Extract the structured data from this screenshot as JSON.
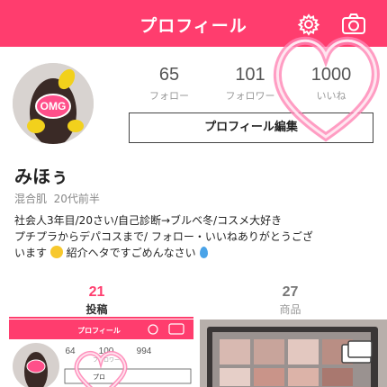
{
  "header": {
    "title": "プロフィール",
    "settings_icon": "gear-icon",
    "camera_icon": "camera-icon",
    "color": "#ff3d6e"
  },
  "avatar": {
    "badge_text": "OMG"
  },
  "stats": [
    {
      "value": "65",
      "label": "フォロー"
    },
    {
      "value": "101",
      "label": "フォロワー"
    },
    {
      "value": "1000",
      "label": "いいね"
    }
  ],
  "edit_button": "プロフィール編集",
  "profile": {
    "name": "みほぅ",
    "skin_type": "混合肌",
    "age": "20代前半",
    "bio_lines": [
      "社会人3年目/20さい/自己診断→ブルベ冬/コスメ大好き",
      "プチプラからデパコスまで/ フォロー・いいねありがとうござ",
      "います",
      "紹介ヘタですごめんなさい"
    ]
  },
  "tabs": [
    {
      "count": "21",
      "label": "投稿"
    },
    {
      "count": "27",
      "label": "商品"
    }
  ],
  "thumbnail": {
    "title": "プロフィール",
    "stats": [
      "64",
      "100",
      "994"
    ],
    "stat_label": "フォロワー",
    "button": "プロ"
  }
}
